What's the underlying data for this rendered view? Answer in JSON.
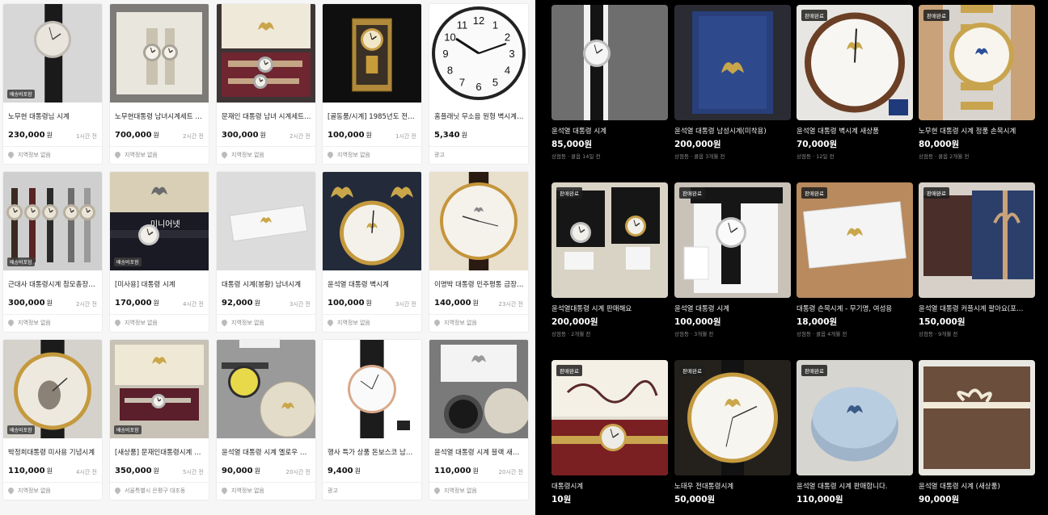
{
  "left_listings": [
    {
      "title": "노무현 대통령님 시계",
      "price": "230,000",
      "won": "원",
      "time": "1시간 전",
      "location": "지역정보 없음",
      "badge": "배송비포함"
    },
    {
      "title": "노무현대통령 남녀시계세트 …",
      "price": "700,000",
      "won": "원",
      "time": "2시간 전",
      "location": "지역정보 없음",
      "badge": ""
    },
    {
      "title": "문재인 대통령 남녀 시계세트…",
      "price": "300,000",
      "won": "원",
      "time": "2시간 전",
      "location": "지역정보 없음",
      "badge": ""
    },
    {
      "title": "[골동품/시계] 1985년도 전…",
      "price": "100,000",
      "won": "원",
      "time": "1시간 전",
      "location": "지역정보 없음",
      "badge": ""
    },
    {
      "title": "홈플래닛 무소음 원형 벽시계…",
      "price": "5,340",
      "won": "원",
      "time": "",
      "location": "",
      "ad": "광고",
      "badge": ""
    },
    {
      "title": "근대사 대통령시계 참모총장…",
      "price": "300,000",
      "won": "원",
      "time": "2시간 전",
      "location": "지역정보 없음",
      "badge": "배송비포함"
    },
    {
      "title": "[미사용] 대통령 시계",
      "price": "170,000",
      "won": "원",
      "time": "4시간 전",
      "location": "지역정보 없음",
      "badge": "배송비포함"
    },
    {
      "title": "대통령 시계(봉황) 남녀시계",
      "price": "92,000",
      "won": "원",
      "time": "3시간 전",
      "location": "지역정보 없음",
      "badge": ""
    },
    {
      "title": "윤석열 대통령 벽시계",
      "price": "100,000",
      "won": "원",
      "time": "3시간 전",
      "location": "지역정보 없음",
      "badge": ""
    },
    {
      "title": "이명박 대통령 민주평통 금장…",
      "price": "140,000",
      "won": "원",
      "time": "23시간 전",
      "location": "지역정보 없음",
      "badge": ""
    },
    {
      "title": "박정희대통령 미사용 기념시계",
      "price": "110,000",
      "won": "원",
      "time": "4시간 전",
      "location": "지역정보 없음",
      "badge": "배송비포함"
    },
    {
      "title": "[새상품] 문재인대통령시계 …",
      "price": "350,000",
      "won": "원",
      "time": "5시간 전",
      "location": "서울특별시 은평구 대조동",
      "badge": "배송비포함"
    },
    {
      "title": "윤석열 대통령 시계 옐로우 …",
      "price": "90,000",
      "won": "원",
      "time": "20시간 전",
      "location": "지역정보 없음",
      "badge": ""
    },
    {
      "title": "행사 특가 상품 돈보스코 남…",
      "price": "9,400",
      "won": "원",
      "time": "",
      "location": "",
      "ad": "광고",
      "badge": ""
    },
    {
      "title": "윤석열 대통령 시계 블랙 새…",
      "price": "110,000",
      "won": "원",
      "time": "20시간 전",
      "location": "지역정보 없음",
      "badge": ""
    }
  ],
  "right_listings": [
    {
      "title": "윤석열 대통령 시계",
      "price": "85,000원",
      "meta": "상점등 · 콜옵 14일 전",
      "sold": ""
    },
    {
      "title": "윤석열 대통령 남성시계(미착용)",
      "price": "200,000원",
      "meta": "상점등 · 콜옵 3개월 전",
      "sold": ""
    },
    {
      "title": "윤석열 대통령 벽시계 새상품",
      "price": "70,000원",
      "meta": "상점등 · 12일 전",
      "sold": "판매완료"
    },
    {
      "title": "노무현 대통령 시계 정품 손목시계",
      "price": "80,000원",
      "meta": "상점등 · 콜옵 2개월 전",
      "sold": "판매완료"
    },
    {
      "title": "윤석열대통령 시계 판매해요",
      "price": "200,000원",
      "meta": "상점등 · 2개월 전",
      "sold": "판매완료"
    },
    {
      "title": "윤석열 대통령 시계",
      "price": "100,000원",
      "meta": "상점등 · 3개월 전",
      "sold": "판매완료"
    },
    {
      "title": "대통령 손목시계 - 무기명, 여성용",
      "price": "18,000원",
      "meta": "상점등 · 콜옵 4개월 전",
      "sold": "판매완료"
    },
    {
      "title": "윤석열 대통령 커플시계 팔아요(포…",
      "price": "150,000원",
      "meta": "상점등 · 9개월 전",
      "sold": "판매완료"
    },
    {
      "title": "대통령시계",
      "price": "10원",
      "meta": "",
      "sold": "판매완료"
    },
    {
      "title": "노태우 전대통령시계",
      "price": "50,000원",
      "meta": "",
      "sold": "판매완료"
    },
    {
      "title": "윤석열 대통령 시계 판매합니다.",
      "price": "110,000원",
      "meta": "",
      "sold": "판매완료"
    },
    {
      "title": "윤석열 대통령 시계 (새상품)",
      "price": "90,000원",
      "meta": "",
      "sold": ""
    }
  ],
  "image_text": {
    "wall_clock_numbers": [
      "12",
      "1",
      "2",
      "3",
      "4",
      "5",
      "6",
      "7",
      "8",
      "9",
      "10",
      "11"
    ],
    "minieonet": "미니어넷",
    "wall_numbers_short": [
      "12",
      "3",
      "6",
      "9"
    ]
  },
  "colors": {
    "left_bg": "#f6f6f6",
    "right_bg": "#000000",
    "gold": "#c9a64a"
  }
}
